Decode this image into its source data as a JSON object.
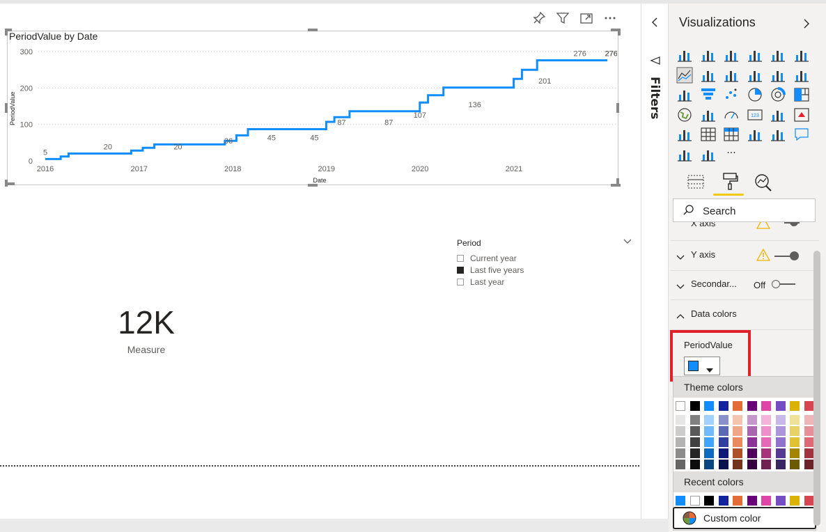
{
  "visual_header": {
    "pin_icon": "pin-icon",
    "filter_icon": "filter-icon",
    "focus_icon": "focus-mode-icon",
    "more_icon": "more-options-icon"
  },
  "chart": {
    "title": "PeriodValue by Date"
  },
  "chart_data": {
    "type": "line",
    "title": "PeriodValue by Date",
    "xlabel": "Date",
    "ylabel": "PeriodValue",
    "x_ticks": [
      "2016",
      "2017",
      "2018",
      "2019",
      "2020",
      "2021"
    ],
    "y_ticks": [
      "0",
      "100",
      "200",
      "300"
    ],
    "ylim": [
      0,
      300
    ],
    "xlim": [
      "2016-01-01",
      "2021-12-31"
    ],
    "grid": "horizontal dotted",
    "color": "#118DFF",
    "series": [
      {
        "points": [
          [
            "2016-01-01",
            5
          ],
          [
            "2016-03-01",
            5
          ],
          [
            "2016-03-01",
            12
          ],
          [
            "2016-04-01",
            12
          ],
          [
            "2016-04-01",
            20
          ],
          [
            "2016-12-01",
            20
          ],
          [
            "2016-12-01",
            28
          ],
          [
            "2017-01-15",
            28
          ],
          [
            "2017-01-15",
            36
          ],
          [
            "2017-03-01",
            36
          ],
          [
            "2017-03-01",
            45
          ],
          [
            "2017-12-01",
            45
          ],
          [
            "2017-12-01",
            55
          ],
          [
            "2018-01-15",
            55
          ],
          [
            "2018-01-15",
            70
          ],
          [
            "2018-03-01",
            70
          ],
          [
            "2018-03-01",
            87
          ],
          [
            "2018-12-31",
            87
          ],
          [
            "2018-12-31",
            107
          ],
          [
            "2019-02-01",
            107
          ],
          [
            "2019-02-01",
            120
          ],
          [
            "2019-04-01",
            120
          ],
          [
            "2019-04-01",
            136
          ],
          [
            "2019-12-31",
            136
          ],
          [
            "2019-12-31",
            160
          ],
          [
            "2020-02-01",
            160
          ],
          [
            "2020-02-01",
            180
          ],
          [
            "2020-04-01",
            180
          ],
          [
            "2020-04-01",
            201
          ],
          [
            "2020-12-31",
            201
          ],
          [
            "2020-12-31",
            225
          ],
          [
            "2021-02-01",
            225
          ],
          [
            "2021-02-01",
            250
          ],
          [
            "2021-04-01",
            250
          ],
          [
            "2021-04-01",
            276
          ],
          [
            "2021-12-31",
            276
          ]
        ]
      }
    ],
    "data_labels": [
      {
        "x": "2016-01-01",
        "text": "5"
      },
      {
        "x": "2016-09-01",
        "text": "20"
      },
      {
        "x": "2017-06-01",
        "text": "20"
      },
      {
        "x": "2017-12-15",
        "text": "36"
      },
      {
        "x": "2018-06-01",
        "text": "45"
      },
      {
        "x": "2018-11-15",
        "text": "45"
      },
      {
        "x": "2019-03-01",
        "text": "87"
      },
      {
        "x": "2019-09-01",
        "text": "87"
      },
      {
        "x": "2019-12-31",
        "text": "107"
      },
      {
        "x": "2020-08-01",
        "text": "136"
      },
      {
        "x": "2021-05-01",
        "text": "201"
      },
      {
        "x": "2021-09-15",
        "text": "276"
      },
      {
        "x": "2022-01-15",
        "text": "276"
      },
      {
        "x": "2022-09-30",
        "text": "276"
      }
    ]
  },
  "slicer": {
    "title": "Period",
    "items": [
      {
        "label": "Current year",
        "checked": false
      },
      {
        "label": "Last five years",
        "checked": true
      },
      {
        "label": "Last year",
        "checked": false
      }
    ]
  },
  "card": {
    "value": "12K",
    "label": "Measure"
  },
  "filters": {
    "label": "Filters"
  },
  "viz_pane": {
    "title": "Visualizations",
    "more_glyph": "···",
    "search": {
      "label": "Search"
    },
    "sections": [
      {
        "label": "X axis"
      },
      {
        "label": "Y axis"
      },
      {
        "label": "Secondar...",
        "toggle": "Off"
      },
      {
        "label": "Data colors"
      }
    ],
    "data_colors": {
      "field": "PeriodValue",
      "current_color": "#118DFF"
    },
    "palette": {
      "theme_title": "Theme colors",
      "recent_title": "Recent colors",
      "custom_label": "Custom color",
      "theme_base": [
        "#FFFFFF",
        "#000000",
        "#118DFF",
        "#12239E",
        "#E66C37",
        "#6B007B",
        "#E044A7",
        "#744EC2",
        "#D9B300",
        "#D64550"
      ],
      "theme_shades": [
        [
          "#E6E6E6",
          "#808080",
          "#A0D1FF",
          "#8A91CA",
          "#F5C4AF",
          "#C499CA",
          "#F3B4DC",
          "#C7B8E7",
          "#F0E199",
          "#EFB5B9"
        ],
        [
          "#CCCCCC",
          "#595959",
          "#70BBFF",
          "#5D69B5",
          "#F0A787",
          "#A866B0",
          "#EC8FCA",
          "#AC95DA",
          "#E8D166",
          "#E68F96"
        ],
        [
          "#B3B3B3",
          "#404040",
          "#41A4FF",
          "#303EA0",
          "#EB895F",
          "#8B3396",
          "#E669B9",
          "#9071CE",
          "#E1C233",
          "#DE6A73"
        ],
        [
          "#8C8C8C",
          "#262626",
          "#0D6ABF",
          "#0E1A77",
          "#AD5129",
          "#50005C",
          "#A8337D",
          "#573B92",
          "#A38600",
          "#A1343C"
        ],
        [
          "#666666",
          "#0D0D0D",
          "#094780",
          "#09124F",
          "#73361C",
          "#36003E",
          "#702253",
          "#3A2761",
          "#6D5A00",
          "#6B2328"
        ]
      ],
      "recent": [
        "#118DFF",
        "#FFFFFF",
        "#000000",
        "#12239E",
        "#E66C37",
        "#6B007B",
        "#E044A7",
        "#744EC2",
        "#D9B300",
        "#D64550"
      ]
    }
  }
}
